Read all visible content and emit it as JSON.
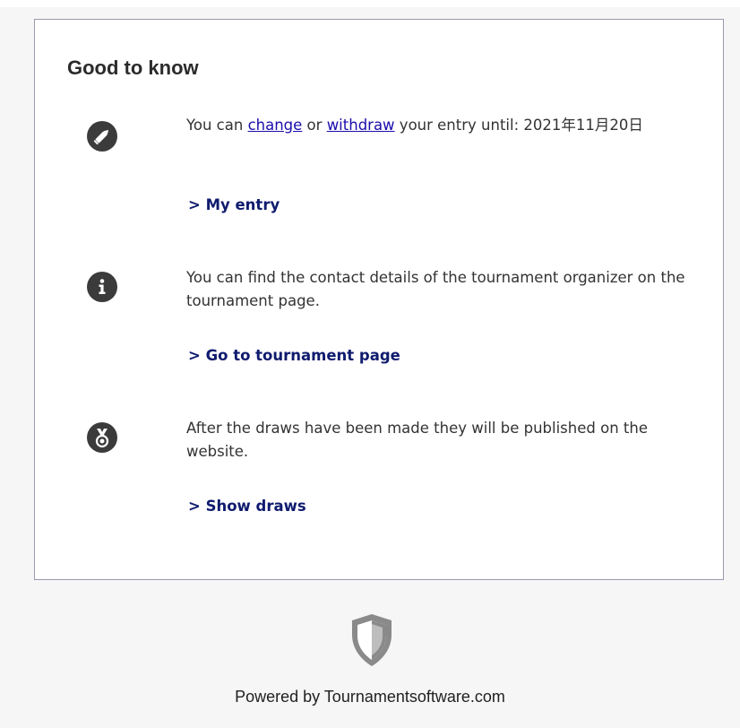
{
  "card": {
    "title": "Good to know",
    "items": [
      {
        "icon": "pencil-icon",
        "text_prefix": "You can ",
        "link_change": "change",
        "text_or": " or ",
        "link_withdraw": "withdraw",
        "text_suffix": " your entry until: 2021年11月20日",
        "action": "> My entry"
      },
      {
        "icon": "info-icon",
        "text": "You can find the contact details of the tournament organizer on the tournament page.",
        "action": "> Go to tournament page"
      },
      {
        "icon": "medal-icon",
        "text": "After the draws have been made they will be published on the website.",
        "action": "> Show draws"
      }
    ]
  },
  "footer": {
    "logo_icon": "shield-icon",
    "powered_by": "Powered by Tournamentsoftware.com"
  },
  "colors": {
    "link": "#1a0dab",
    "action_link": "#0f1b6e",
    "icon_bg": "#3b3b3b",
    "page_bg": "#f6f6f7",
    "card_border": "#9a9ab0"
  }
}
